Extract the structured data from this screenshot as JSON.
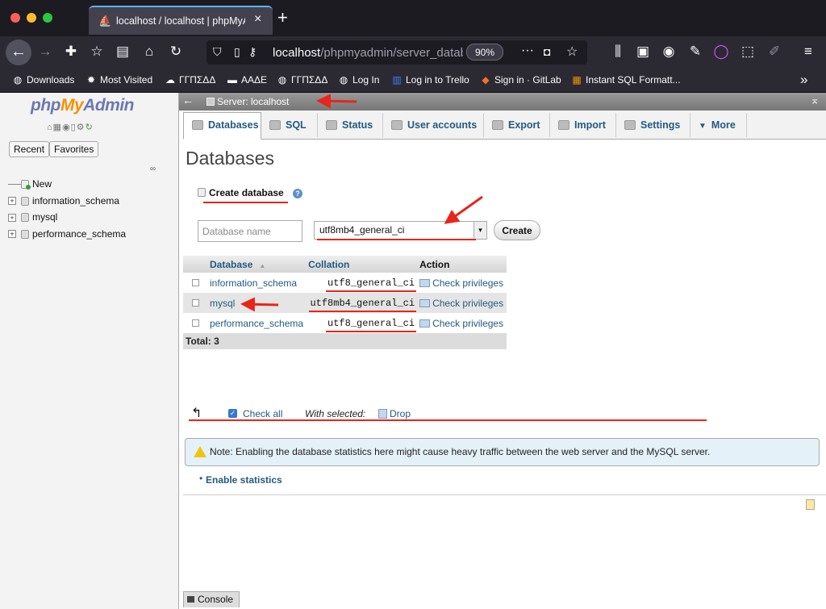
{
  "browser": {
    "tab_title": "localhost / localhost | phpMyAd",
    "tab_close": "×",
    "new_tab": "+",
    "url_host": "localhost",
    "url_path": "/phpmyadmin/server_datab",
    "zoom": "90%",
    "url_more": "···",
    "bookmarks": [
      {
        "label": "Downloads",
        "icon": "globe-icon",
        "glyph": "◍"
      },
      {
        "label": "Most Visited",
        "icon": "gear-icon",
        "glyph": "✹"
      },
      {
        "label": "ΓΓΠΣΔΔ",
        "icon": "cloud-icon",
        "glyph": "☁"
      },
      {
        "label": "ΑΑΔΕ",
        "icon": "flag-icon",
        "glyph": "▬"
      },
      {
        "label": "ΓΓΠΣΔΔ",
        "icon": "globe-icon",
        "glyph": "◍"
      },
      {
        "label": "Log In",
        "icon": "globe-icon",
        "glyph": "◍"
      },
      {
        "label": "Log in to Trello",
        "icon": "trello-icon",
        "glyph": "▥"
      },
      {
        "label": "Sign in · GitLab",
        "icon": "gitlab-icon",
        "glyph": "◆"
      },
      {
        "label": "Instant SQL Formatt...",
        "icon": "sql-icon",
        "glyph": "▦"
      }
    ],
    "overflow": "»"
  },
  "nav": {
    "logo_php": "php",
    "logo_my": "My",
    "logo_admin": "Admin",
    "recent": "Recent",
    "favorites": "Favorites",
    "tree": [
      {
        "label": "New"
      },
      {
        "label": "information_schema"
      },
      {
        "label": "mysql"
      },
      {
        "label": "performance_schema"
      }
    ]
  },
  "topbar": {
    "server": "Server: localhost"
  },
  "menu": [
    {
      "label": "Databases",
      "active": true
    },
    {
      "label": "SQL"
    },
    {
      "label": "Status"
    },
    {
      "label": "User accounts"
    },
    {
      "label": "Export"
    },
    {
      "label": "Import"
    },
    {
      "label": "Settings"
    },
    {
      "label": "More"
    }
  ],
  "main": {
    "heading": "Databases",
    "create_title": "Create database",
    "db_name_placeholder": "Database name",
    "collation_selected": "utf8mb4_general_ci",
    "create_button": "Create",
    "table": {
      "headers": [
        "Database",
        "Collation",
        "Action"
      ],
      "rows": [
        {
          "name": "information_schema",
          "collation": "utf8_general_ci",
          "action": "Check privileges"
        },
        {
          "name": "mysql",
          "collation": "utf8mb4_general_ci",
          "action": "Check privileges"
        },
        {
          "name": "performance_schema",
          "collation": "utf8_general_ci",
          "action": "Check privileges"
        }
      ],
      "total": "Total: 3"
    },
    "check_all": "Check all",
    "with_selected": "With selected:",
    "drop": "Drop",
    "note": "Note: Enabling the database statistics here might cause heavy traffic between the web server and the MySQL server.",
    "enable_stats": "Enable statistics"
  },
  "console": {
    "label": "Console"
  },
  "colors": {
    "link": "#235a81",
    "annotation": "#e8251b",
    "logo_orange": "#f39200",
    "logo_blue": "#6c78b1"
  }
}
